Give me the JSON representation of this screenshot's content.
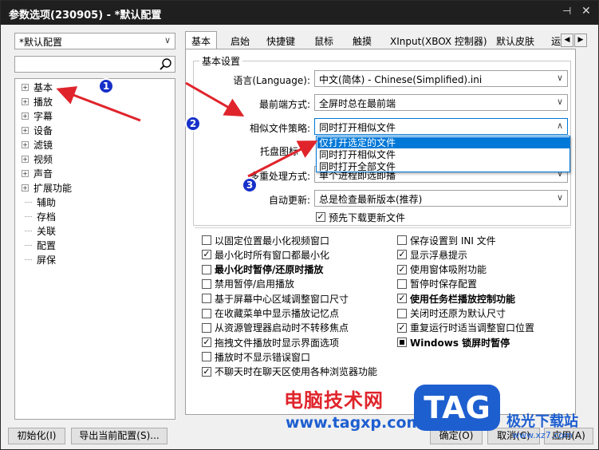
{
  "window": {
    "title": "参数选项(230905) - *默认配置",
    "pin_icon": "pin-icon",
    "close_icon": "close-icon"
  },
  "left": {
    "preset": "*默认配置",
    "search_placeholder": "",
    "tree": [
      {
        "label": "基本",
        "expand": "+"
      },
      {
        "label": "播放",
        "expand": "+"
      },
      {
        "label": "字幕",
        "expand": "+"
      },
      {
        "label": "设备",
        "expand": "+"
      },
      {
        "label": "滤镜",
        "expand": "+"
      },
      {
        "label": "视频",
        "expand": "+"
      },
      {
        "label": "声音",
        "expand": "+"
      },
      {
        "label": "扩展功能",
        "expand": "+"
      },
      {
        "label": "辅助",
        "expand": ""
      },
      {
        "label": "存档",
        "expand": ""
      },
      {
        "label": "关联",
        "expand": ""
      },
      {
        "label": "配置",
        "expand": ""
      },
      {
        "label": "屏保",
        "expand": ""
      }
    ]
  },
  "tabs": [
    "基本",
    "启始",
    "快捷键",
    "鼠标",
    "触摸",
    "XInput(XBOX 控制器)",
    "默认皮肤",
    "运"
  ],
  "scroll": {
    "left": "◀",
    "right": "▶"
  },
  "group": {
    "title": "基本设置",
    "language_label": "语言(Language):",
    "language_value": "中文(简体) - Chinese(Simplified).ini",
    "topmost_label": "最前端方式:",
    "topmost_value": "全屏时总在最前端",
    "similar_label": "相似文件策略:",
    "similar_value": "同时打开相似文件",
    "tray_label": "托盘图标",
    "multi_label": "多重处理方式:",
    "multi_value": "单个进程即选即播",
    "update_label": "自动更新:",
    "update_value": "总是检查最新版本(推荐)",
    "predownload": "预先下载更新文件"
  },
  "dropdown": [
    "仅打开选定的文件",
    "同时打开相似文件",
    "同时打开全部文件"
  ],
  "options_left": [
    {
      "label": "以固定位置最小化视频窗口",
      "checked": false,
      "bold": false
    },
    {
      "label": "最小化时所有窗口都最小化",
      "checked": true,
      "bold": false
    },
    {
      "label": "最小化时暂停/还原时播放",
      "checked": false,
      "bold": true
    },
    {
      "label": "禁用暂停/启用播放",
      "checked": false,
      "bold": false
    },
    {
      "label": "基于屏幕中心区域调整窗口尺寸",
      "checked": false,
      "bold": false
    },
    {
      "label": "在收藏菜单中显示播放记忆点",
      "checked": false,
      "bold": false
    },
    {
      "label": "从资源管理器启动时不转移焦点",
      "checked": false,
      "bold": false
    },
    {
      "label": "拖拽文件播放时显示界面选项",
      "checked": true,
      "bold": false
    },
    {
      "label": "播放时不显示错误窗口",
      "checked": false,
      "bold": false
    },
    {
      "label": "不聊天时在聊天区使用各种浏览器功能",
      "checked": true,
      "bold": false
    }
  ],
  "options_right": [
    {
      "label": "保存设置到 INI 文件",
      "checked": false,
      "bold": false
    },
    {
      "label": "显示浮悬提示",
      "checked": true,
      "bold": false
    },
    {
      "label": "使用窗体吸附功能",
      "checked": true,
      "bold": false
    },
    {
      "label": "暂停时保存配置",
      "checked": false,
      "bold": false
    },
    {
      "label": "使用任务栏播放控制功能",
      "checked": true,
      "bold": true
    },
    {
      "label": "关闭时还原为默认尺寸",
      "checked": false,
      "bold": false
    },
    {
      "label": "重复运行时适当调整窗口位置",
      "checked": true,
      "bold": false
    },
    {
      "label": "Windows 锁屏时暂停",
      "checked": "indeterminate",
      "bold": true
    }
  ],
  "buttons": {
    "init": "初始化(I)",
    "export": "导出当前配置(S)...",
    "ok": "确定(O)",
    "cancel": "取消(C)",
    "apply": "应用(A)"
  },
  "badges": [
    "1",
    "2",
    "3"
  ],
  "watermark": {
    "text": "电脑技术网",
    "url": "www.tagxp.com",
    "logo": "TAG",
    "site": "极光下载站",
    "small": "www.xz7.com"
  },
  "colors": {
    "accent": "#0078d7",
    "titlebar": "#1f1f1f",
    "arrow": "#e0242b",
    "badge": "#1730c9"
  }
}
